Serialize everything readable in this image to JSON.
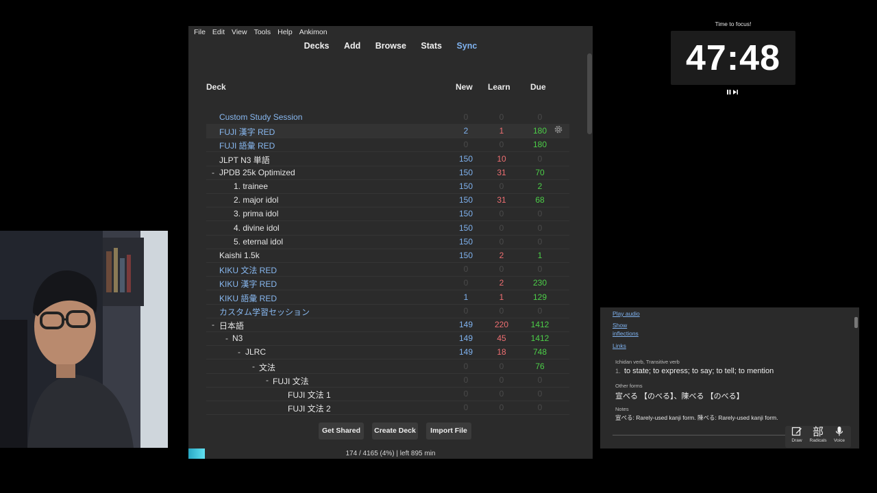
{
  "anki": {
    "menu": [
      "File",
      "Edit",
      "View",
      "Tools",
      "Help",
      "Ankimon"
    ],
    "toolbar": [
      "Decks",
      "Add",
      "Browse",
      "Stats",
      "Sync"
    ],
    "headers": {
      "deck": "Deck",
      "new": "New",
      "learn": "Learn",
      "due": "Due"
    },
    "decks": [
      {
        "name": "Custom Study Session",
        "prefix": "",
        "new": "0",
        "learn": "0",
        "due": "0",
        "blue": true
      },
      {
        "name": "FUJI 漢字 RED",
        "prefix": "",
        "new": "2",
        "learn": "1",
        "due": "180",
        "blue": true,
        "highlight": true
      },
      {
        "name": "FUJI 語彙 RED",
        "prefix": "",
        "new": "0",
        "learn": "0",
        "due": "180",
        "blue": true
      },
      {
        "name": "JLPT N3 単語",
        "prefix": "",
        "new": "150",
        "learn": "10",
        "due": "0"
      },
      {
        "name": "JPDB 25k Optimized",
        "prefix": "-",
        "new": "150",
        "learn": "31",
        "due": "70"
      },
      {
        "name": "1. trainee",
        "prefix": "",
        "new": "150",
        "learn": "0",
        "due": "2"
      },
      {
        "name": "2. major idol",
        "prefix": "",
        "new": "150",
        "learn": "31",
        "due": "68"
      },
      {
        "name": "3. prima idol",
        "prefix": "",
        "new": "150",
        "learn": "0",
        "due": "0"
      },
      {
        "name": "4. divine idol",
        "prefix": "",
        "new": "150",
        "learn": "0",
        "due": "0"
      },
      {
        "name": "5. eternal idol",
        "prefix": "",
        "new": "150",
        "learn": "0",
        "due": "0"
      },
      {
        "name": "Kaishi 1.5k",
        "prefix": "",
        "new": "150",
        "learn": "2",
        "due": "1"
      },
      {
        "name": "KIKU 文法 RED",
        "prefix": "",
        "new": "0",
        "learn": "0",
        "due": "0",
        "blue": true
      },
      {
        "name": "KIKU 漢字 RED",
        "prefix": "",
        "new": "0",
        "learn": "2",
        "due": "230",
        "blue": true
      },
      {
        "name": "KIKU 語彙 RED",
        "prefix": "",
        "new": "1",
        "learn": "1",
        "due": "129",
        "blue": true
      },
      {
        "name": "カスタム学習セッション",
        "prefix": "",
        "new": "0",
        "learn": "0",
        "due": "0",
        "blue": true
      },
      {
        "name": "日本語",
        "prefix": "-",
        "new": "149",
        "learn": "220",
        "due": "1412"
      },
      {
        "name": "N3",
        "prefix": "-",
        "new": "149",
        "learn": "45",
        "due": "1412"
      },
      {
        "name": "JLRC",
        "prefix": "-",
        "new": "149",
        "learn": "18",
        "due": "748"
      },
      {
        "name": "文法",
        "prefix": "-",
        "new": "0",
        "learn": "0",
        "due": "76"
      },
      {
        "name": "FUJI 文法",
        "prefix": "-",
        "new": "0",
        "learn": "0",
        "due": "0"
      },
      {
        "name": "FUJI 文法 1",
        "prefix": "",
        "new": "0",
        "learn": "0",
        "due": "0"
      },
      {
        "name": "FUJI 文法 2",
        "prefix": "",
        "new": "0",
        "learn": "0",
        "due": "0"
      }
    ],
    "buttons": {
      "shared": "Get Shared",
      "create": "Create Deck",
      "import": "Import File"
    },
    "status": "174 / 4165 (4%) | left 895 min",
    "progress_percent": 4
  },
  "timer": {
    "caption": "Time to focus!",
    "value": "47:48"
  },
  "dictionary": {
    "play_audio": "Play audio",
    "show": "Show",
    "inflections": "inflections",
    "links": "Links",
    "pos": "Ichidan verb, Transitive verb",
    "def_index": "1.",
    "definition": "to state; to express; to say; to tell; to mention",
    "other_forms_label": "Other forms",
    "other_forms": "宣べる 【のべる】、陳べる 【のべる】",
    "notes_label": "Notes",
    "notes": "宣べる: Rarely-used kanji form. 陳べる: Rarely-used kanji form.",
    "tools": {
      "draw": "Draw",
      "radicals": "Radicals",
      "radicals_glyph": "部",
      "voice": "Voice"
    }
  }
}
